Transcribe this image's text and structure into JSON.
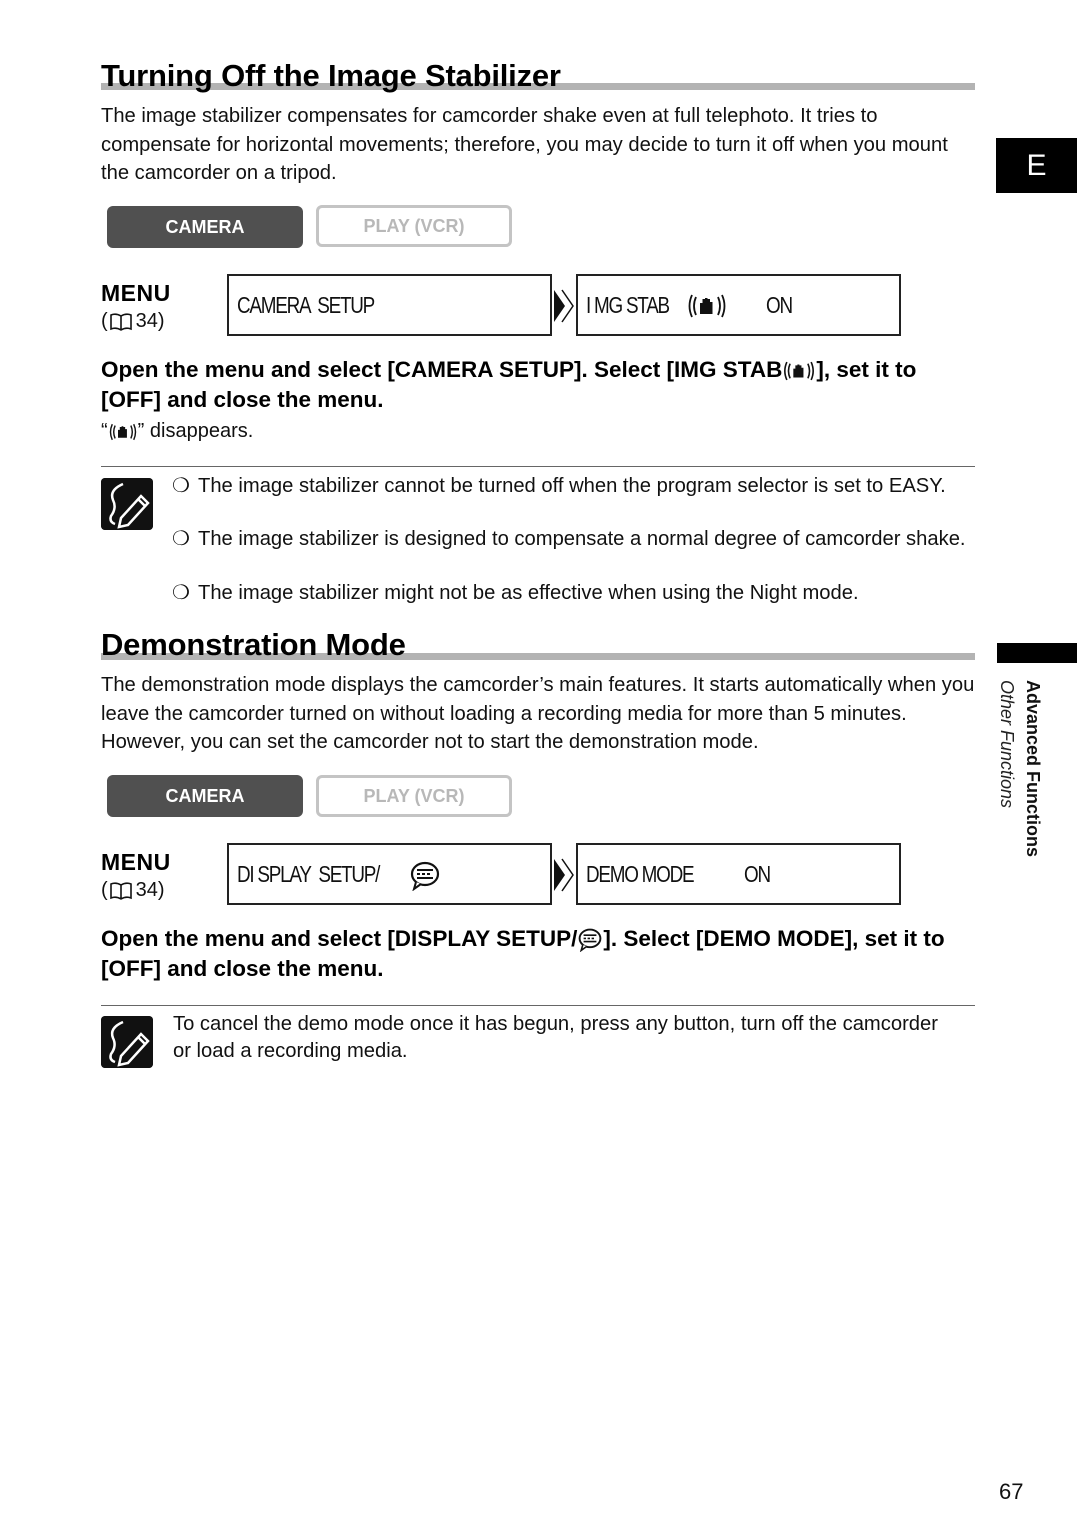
{
  "side": {
    "language_tab": "E",
    "chapter": "Advanced Functions",
    "section": "Other Functions"
  },
  "page_number": "67",
  "section1": {
    "title": "Turning Off the Image Stabilizer",
    "intro": "The image stabilizer compensates for camcorder shake even at full telephoto. It tries to compensate for horizontal movements; therefore, you may decide to turn it off when you mount the camcorder on a tripod.",
    "modes": {
      "camera": "CAMERA",
      "play": "PLAY (VCR)"
    },
    "menu_label": "MENU",
    "menu_ref": "34)",
    "menu_ref_open": "(",
    "lcd_left": "CAMERA  SETUP",
    "lcd_right_label": "I MG STAB",
    "lcd_right_value": "ON",
    "instruction_part1": "Open the menu and select [CAMERA SETUP]. Select [IMG STAB",
    "instruction_part2": "], set it to [OFF] and close the menu.",
    "result_open": "“",
    "result_close": "” disappears.",
    "notes": [
      "The image stabilizer cannot be turned off when the program selector is set to EASY.",
      "The image stabilizer is designed to compensate a normal degree of camcorder shake.",
      "The image stabilizer might not be as effective when using the Night mode."
    ],
    "bullet_glyph": "❍"
  },
  "section2": {
    "title": "Demonstration Mode",
    "intro": "The demonstration mode displays the camcorder’s main features. It starts automatically when you leave the camcorder turned on without loading a recording media for more than 5 minutes. However, you can set the camcorder not to start the demonstration mode.",
    "modes": {
      "camera": "CAMERA",
      "play": "PLAY (VCR)"
    },
    "menu_label": "MENU",
    "menu_ref": "34)",
    "menu_ref_open": "(",
    "lcd_left": "DI SPLAY  SETUP/",
    "lcd_right_label": "DEMO MODE",
    "lcd_right_value": "ON",
    "instruction_part1": "Open the menu and select [DISPLAY SETUP/",
    "instruction_part2": "]. Select [DEMO MODE], set it to [OFF] and close the menu.",
    "note": "To cancel the demo mode once it has begun, press any button, turn off the camcorder or load a recording media."
  }
}
